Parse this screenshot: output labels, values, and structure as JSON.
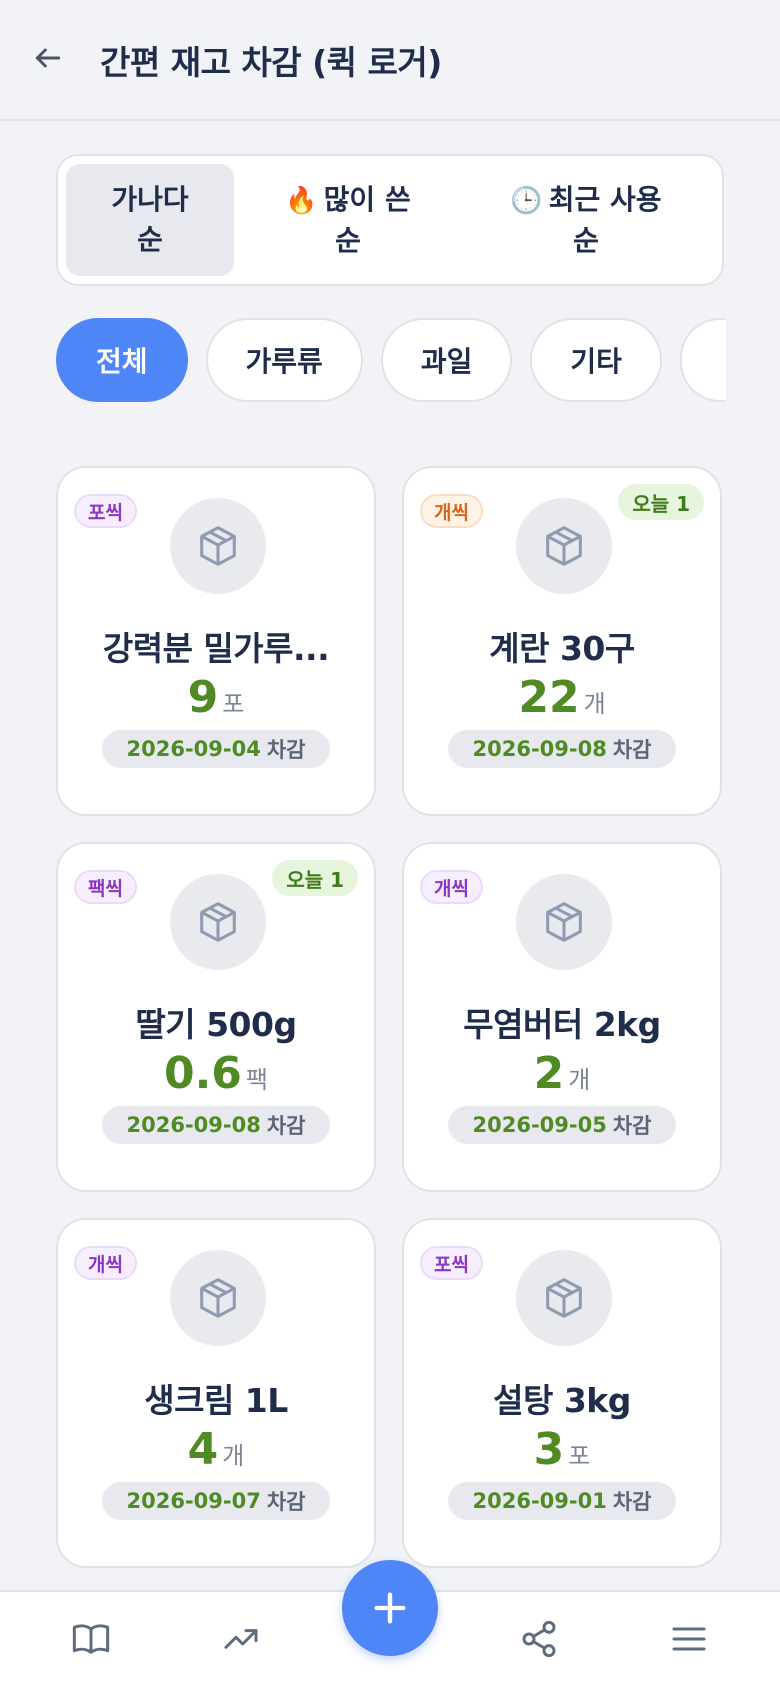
{
  "header": {
    "title": "간편 재고 차감 (퀵 로거)"
  },
  "sort": {
    "options": [
      {
        "label": "가나다\n순",
        "line1": "가나다",
        "line2": "순",
        "icon": ""
      },
      {
        "line1": "많이 쓴",
        "line2": "순",
        "icon": "🔥"
      },
      {
        "line1": "최근 사용",
        "line2": "순",
        "icon": "🕒"
      }
    ]
  },
  "chips": [
    "전체",
    "가루류",
    "과일",
    "기타",
    ""
  ],
  "cards": [
    {
      "pack": "포씩",
      "pack_color": "purple",
      "today": "",
      "name": "강력분 밀가루...",
      "qty": "9",
      "unit": "포",
      "date": "2026-09-04",
      "suffix": "차감"
    },
    {
      "pack": "개씩",
      "pack_color": "orange",
      "today": "오늘 1",
      "name": "계란 30구",
      "qty": "22",
      "unit": "개",
      "date": "2026-09-08",
      "suffix": "차감"
    },
    {
      "pack": "팩씩",
      "pack_color": "purple",
      "today": "오늘 1",
      "name": "딸기 500g",
      "qty": "0.6",
      "unit": "팩",
      "date": "2026-09-08",
      "suffix": "차감"
    },
    {
      "pack": "개씩",
      "pack_color": "purple",
      "today": "",
      "name": "무염버터 2kg",
      "qty": "2",
      "unit": "개",
      "date": "2026-09-05",
      "suffix": "차감"
    },
    {
      "pack": "개씩",
      "pack_color": "purple",
      "today": "",
      "name": "생크림 1L",
      "qty": "4",
      "unit": "개",
      "date": "2026-09-07",
      "suffix": "차감"
    },
    {
      "pack": "포씩",
      "pack_color": "purple",
      "today": "",
      "name": "설탕 3kg",
      "qty": "3",
      "unit": "포",
      "date": "2026-09-01",
      "suffix": "차감"
    }
  ],
  "nav": {
    "icons": [
      "book-icon",
      "trending-icon",
      "plus-icon",
      "share-icon",
      "menu-icon"
    ]
  },
  "colors": {
    "accent": "#4f86f7",
    "qty_green": "#4f8a24"
  }
}
